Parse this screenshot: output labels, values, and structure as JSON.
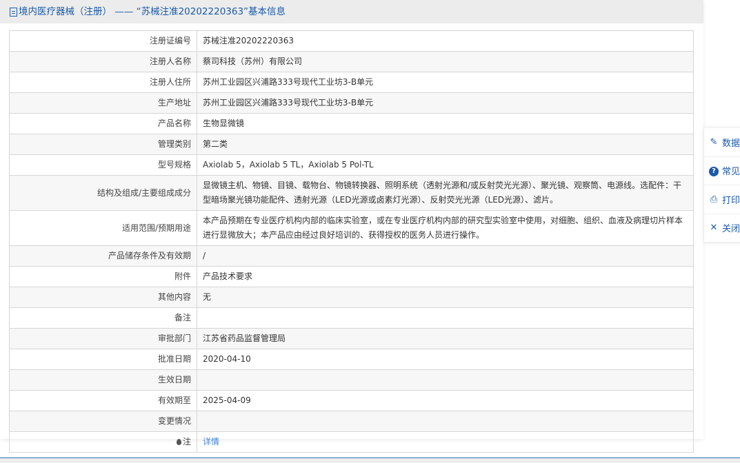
{
  "title": "境内医疗器械（注册） —— “苏械注准20202220363”基本信息",
  "rows": [
    {
      "label": "注册证编号",
      "value": "苏械注准20202220363"
    },
    {
      "label": "注册人名称",
      "value": "蔡司科技（苏州）有限公司"
    },
    {
      "label": "注册人住所",
      "value": "苏州工业园区兴浦路333号现代工业坊3-B单元"
    },
    {
      "label": "生产地址",
      "value": "苏州工业园区兴浦路333号现代工业坊3-B单元"
    },
    {
      "label": "产品名称",
      "value": "生物显微镜"
    },
    {
      "label": "管理类别",
      "value": "第二类"
    },
    {
      "label": "型号规格",
      "value": "Axiolab 5，Axiolab 5 TL，Axiolab 5 Pol-TL"
    },
    {
      "label": "结构及组成/主要组成成分",
      "value": "显微镜主机、物镜、目镜、载物台、物镜转换器、照明系统（透射光源和/或反射荧光光源）、聚光镜、观察筒、电源线。选配件：干型暗场聚光镜功能配件、透射光源（LED光源或卤素灯光源）、反射荧光光源（LED光源）、滤片。"
    },
    {
      "label": "适用范围/预期用途",
      "value": "本产品预期在专业医疗机构内部的临床实验室，或在专业医疗机构内部的研究型实验室中使用，对细胞、组织、血液及病理切片样本进行显微放大；本产品应由经过良好培训的、获得授权的医务人员进行操作。"
    },
    {
      "label": "产品储存条件及有效期",
      "value": "/"
    },
    {
      "label": "附件",
      "value": "产品技术要求"
    },
    {
      "label": "其他内容",
      "value": "无"
    },
    {
      "label": "备注",
      "value": ""
    },
    {
      "label": "审批部门",
      "value": "江苏省药品监督管理局"
    },
    {
      "label": "批准日期",
      "value": "2020-04-10"
    },
    {
      "label": "生效日期",
      "value": ""
    },
    {
      "label": "有效期至",
      "value": "2025-04-09"
    },
    {
      "label": "变更情况",
      "value": ""
    }
  ],
  "note": {
    "label": "注",
    "link": "详情"
  },
  "side": [
    "数据",
    "常见",
    "打印",
    "关闭"
  ]
}
